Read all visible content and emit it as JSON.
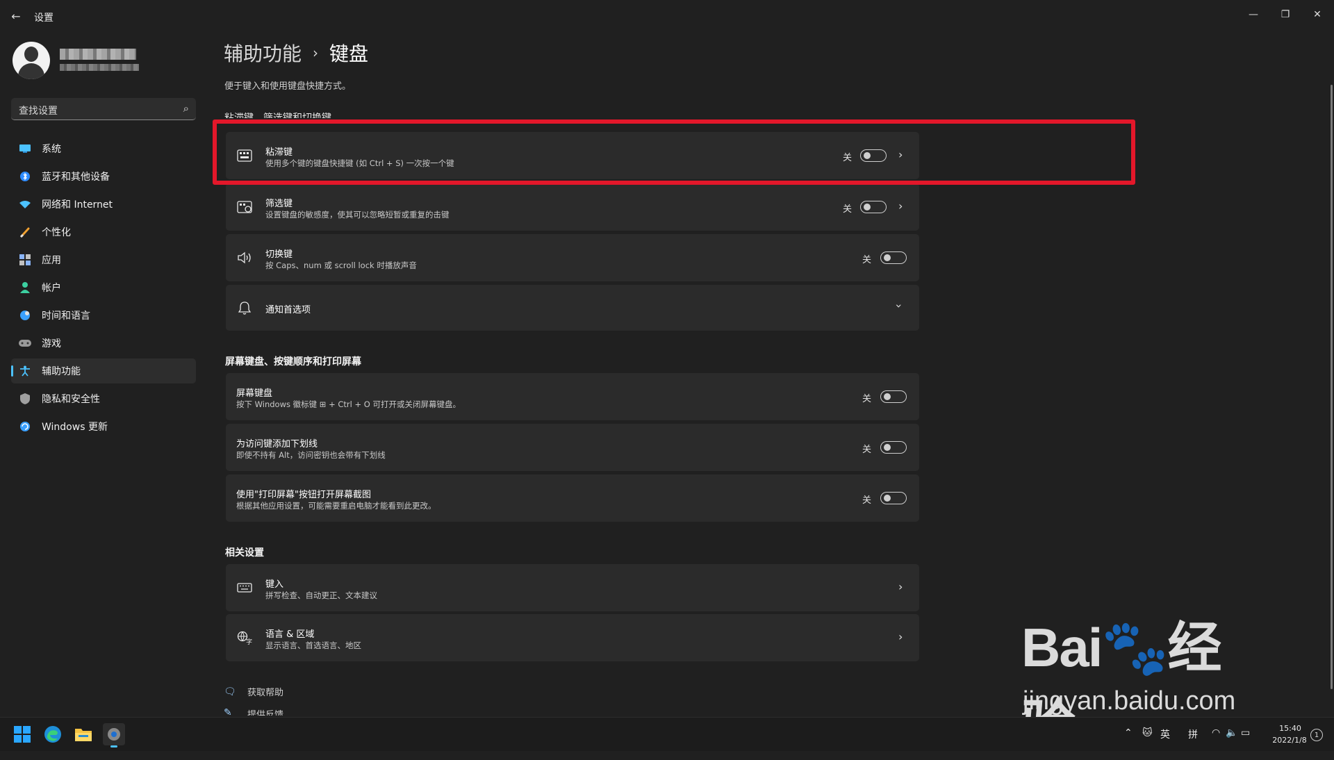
{
  "window": {
    "app_title": "设置",
    "back_icon": "arrow-left-icon",
    "controls": [
      "minimize-icon",
      "restore-icon",
      "close-icon"
    ]
  },
  "search": {
    "placeholder": "查找设置"
  },
  "sidebar": {
    "items": [
      {
        "label": "系统",
        "icon": "monitor-icon",
        "color": "#4cc2ff"
      },
      {
        "label": "蓝牙和其他设备",
        "icon": "bluetooth-icon",
        "color": "#2f8cff"
      },
      {
        "label": "网络和 Internet",
        "icon": "wifi-icon",
        "color": "#4cc2ff"
      },
      {
        "label": "个性化",
        "icon": "brush-icon",
        "color": "#f0a030"
      },
      {
        "label": "应用",
        "icon": "apps-icon",
        "color": "#8ab4f8"
      },
      {
        "label": "帐户",
        "icon": "person-icon",
        "color": "#3ccfa0"
      },
      {
        "label": "时间和语言",
        "icon": "globe-clock-icon",
        "color": "#3aa0ff"
      },
      {
        "label": "游戏",
        "icon": "gamepad-icon",
        "color": "#b0b0b0"
      },
      {
        "label": "辅助功能",
        "icon": "accessibility-icon",
        "color": "#4cc2ff",
        "active": true
      },
      {
        "label": "隐私和安全性",
        "icon": "shield-icon",
        "color": "#a0a0a0"
      },
      {
        "label": "Windows 更新",
        "icon": "update-icon",
        "color": "#3aa0ff"
      }
    ]
  },
  "breadcrumb": {
    "parent": "辅助功能",
    "separator": "›",
    "current": "键盘"
  },
  "page_description": "便于键入和使用键盘快捷方式。",
  "section_partial_heading": "粘滞键、筛选键和切换键",
  "group1": [
    {
      "title": "粘滞键",
      "subtitle": "使用多个键的键盘快捷键 (如 Ctrl + S) 一次按一个键",
      "state": "关",
      "icon": "sticky-keys-icon"
    },
    {
      "title": "筛选键",
      "subtitle": "设置键盘的敏感度，使其可以忽略短暂或重复的击键",
      "state": "关",
      "icon": "filter-keys-icon"
    },
    {
      "title": "切换键",
      "subtitle": "按 Caps、num 或 scroll lock 时播放声音",
      "state": "关",
      "icon": "speaker-icon"
    },
    {
      "title": "通知首选项",
      "icon": "bell-icon"
    }
  ],
  "section2": {
    "heading": "屏幕键盘、按键顺序和打印屏幕",
    "items": [
      {
        "title": "屏幕键盘",
        "subtitle": "按下 Windows 徽标键 ⊞ + Ctrl + O 可打开或关闭屏幕键盘。",
        "state": "关"
      },
      {
        "title": "为访问键添加下划线",
        "subtitle": "即使不持有 Alt，访问密钥也会带有下划线",
        "state": "关"
      },
      {
        "title": "使用\"打印屏幕\"按钮打开屏幕截图",
        "subtitle": "根据其他应用设置，可能需要重启电脑才能看到此更改。",
        "state": "关"
      }
    ]
  },
  "section3": {
    "heading": "相关设置",
    "items": [
      {
        "title": "键入",
        "subtitle": "拼写检查、自动更正、文本建议",
        "icon": "keyboard-icon"
      },
      {
        "title": "语言 & 区域",
        "subtitle": "显示语言、首选语言、地区",
        "icon": "language-icon"
      }
    ]
  },
  "footer": {
    "help": "获取帮助",
    "feedback": "提供反馈"
  },
  "taskbar": {
    "apps": [
      "windows-start-icon",
      "edge-icon",
      "file-explorer-icon",
      "settings-gear-icon"
    ],
    "tray": {
      "ime_lang": "英",
      "ime_mode": "拼",
      "time": "15:40",
      "date": "2022/1/8",
      "notification_count": "1"
    }
  },
  "watermark": {
    "main": "Bai🐾经验",
    "sub": "jingyan.baidu.com"
  },
  "colors": {
    "accent": "#4cc2ff",
    "highlight": "#e3172a",
    "background": "#202020",
    "card": "#2b2b2b"
  }
}
